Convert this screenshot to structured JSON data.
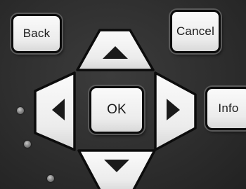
{
  "buttons": {
    "back": "Back",
    "cancel": "Cancel",
    "ok": "OK",
    "info": "Info"
  },
  "arrows": {
    "up": "triangle-up-icon",
    "down": "triangle-down-icon",
    "left": "triangle-left-icon",
    "right": "triangle-right-icon"
  },
  "indicator_leds": 3,
  "colors": {
    "panel": "#2e2e2e",
    "button_face": "#f2f2f2",
    "button_border": "#0c0c0c",
    "glyph": "#1a1a1a"
  }
}
